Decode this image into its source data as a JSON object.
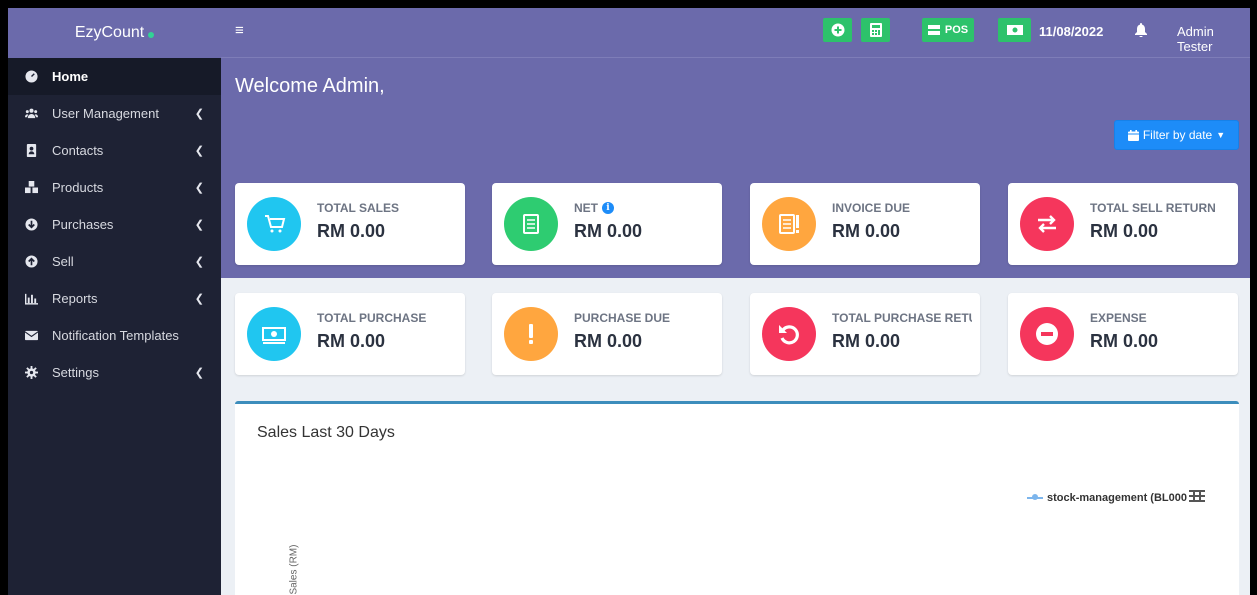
{
  "brand": {
    "name": "EzyCount"
  },
  "sidebar": {
    "items": [
      {
        "label": "Home",
        "icon": "dashboard-icon",
        "active": true,
        "chevron": false
      },
      {
        "label": "User Management",
        "icon": "users-icon",
        "active": false,
        "chevron": true
      },
      {
        "label": "Contacts",
        "icon": "address-book-icon",
        "active": false,
        "chevron": true
      },
      {
        "label": "Products",
        "icon": "cubes-icon",
        "active": false,
        "chevron": true
      },
      {
        "label": "Purchases",
        "icon": "arrow-circle-down-icon",
        "active": false,
        "chevron": true
      },
      {
        "label": "Sell",
        "icon": "arrow-circle-up-icon",
        "active": false,
        "chevron": true
      },
      {
        "label": "Reports",
        "icon": "bar-chart-icon",
        "active": false,
        "chevron": true
      },
      {
        "label": "Notification Templates",
        "icon": "envelope-icon",
        "active": false,
        "chevron": false
      },
      {
        "label": "Settings",
        "icon": "cog-icon",
        "active": false,
        "chevron": true
      }
    ]
  },
  "topbar": {
    "pos_label": "POS",
    "date": "11/08/2022",
    "user": "Admin Tester",
    "accent": "#2dc26b"
  },
  "hero": {
    "welcome": "Welcome Admin,",
    "filter_label": "Filter by date",
    "background": "#6b6aab"
  },
  "cards": [
    {
      "label": "TOTAL SALES",
      "value": "RM 0.00",
      "color": "#20c6f0",
      "icon": "cart-icon"
    },
    {
      "label": "NET",
      "value": "RM 0.00",
      "color": "#2ecc71",
      "icon": "list-icon",
      "info": true
    },
    {
      "label": "INVOICE DUE",
      "value": "RM 0.00",
      "color": "#ffa63f",
      "icon": "invoice-alert-icon"
    },
    {
      "label": "TOTAL SELL RETURN",
      "value": "RM 0.00",
      "color": "#f5365c",
      "icon": "exchange-icon"
    },
    {
      "label": "TOTAL PURCHASE",
      "value": "RM 0.00",
      "color": "#20c6f0",
      "icon": "money-icon"
    },
    {
      "label": "PURCHASE DUE",
      "value": "RM 0.00",
      "color": "#ffa63f",
      "icon": "exclamation-icon"
    },
    {
      "label": "TOTAL PURCHASE RETURN",
      "value": "RM 0.00",
      "color": "#f5365c",
      "icon": "undo-icon"
    },
    {
      "label": "EXPENSE",
      "value": "RM 0.00",
      "color": "#f5365c",
      "icon": "minus-circle-icon"
    }
  ],
  "sales_chart": {
    "title": "Sales Last 30 Days",
    "legend": "stock-management (BL000",
    "y_label": "Total Sales (RM)",
    "series_color": "#7cb5ec"
  }
}
